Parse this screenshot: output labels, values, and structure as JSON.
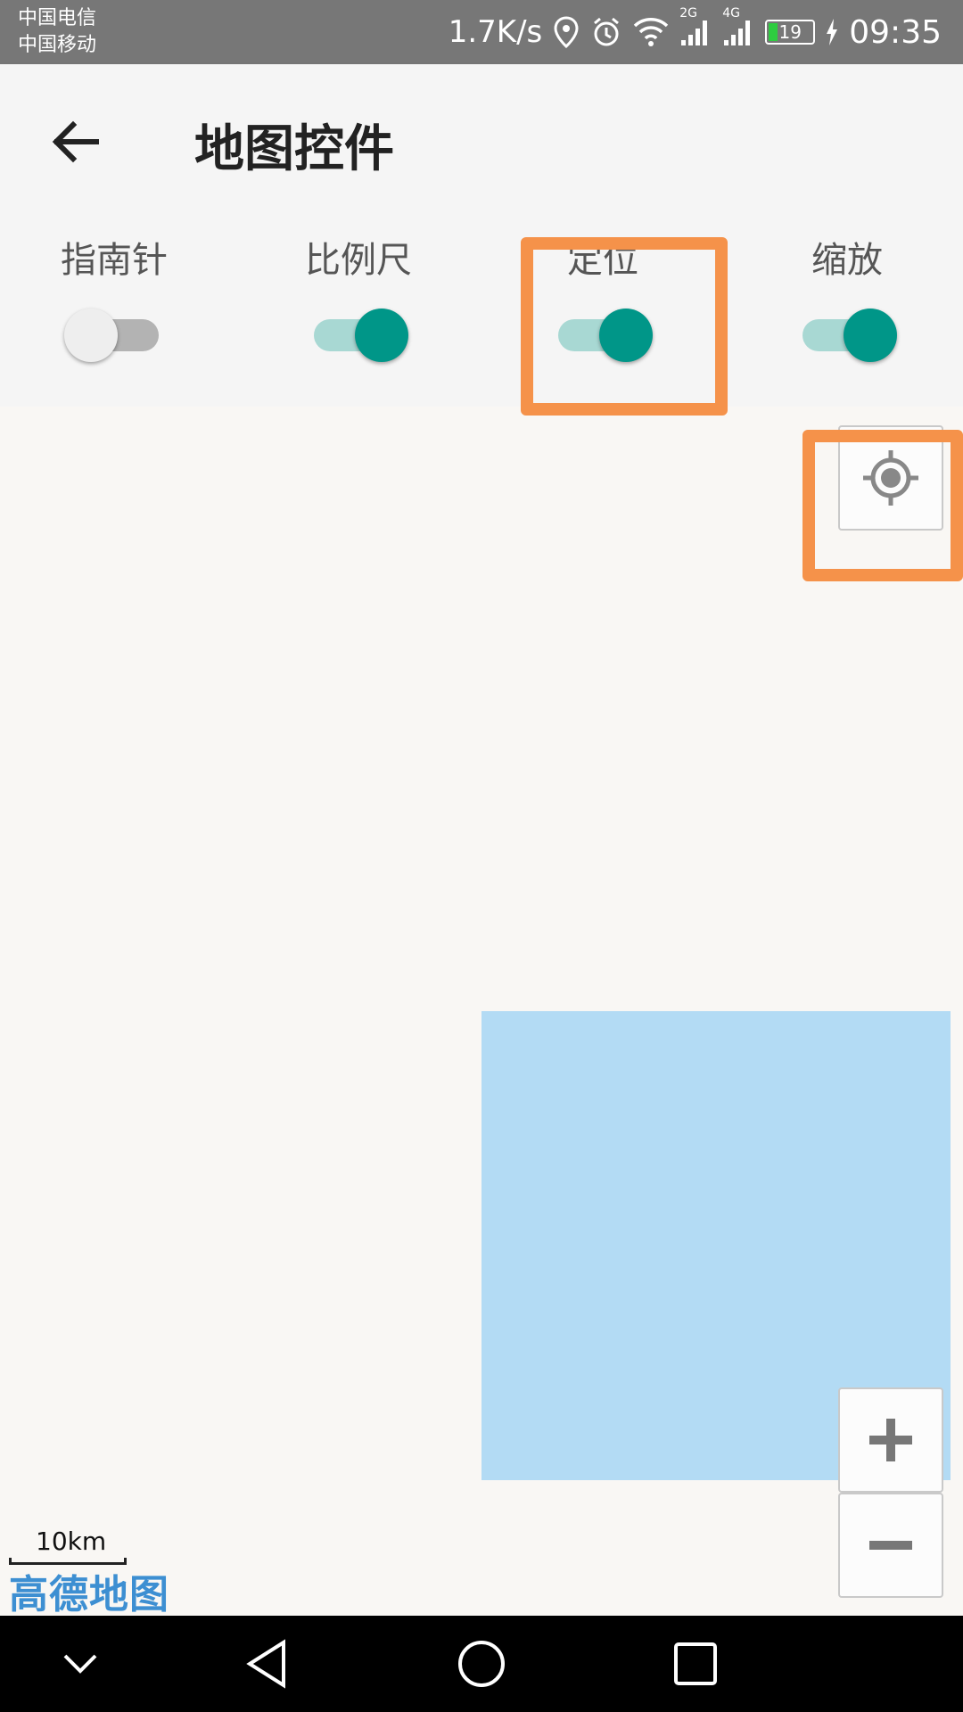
{
  "status_bar": {
    "carrier_1": "中国电信",
    "carrier_2": "中国移动",
    "net_speed": "1.7K/s",
    "signal_1_label": "2G",
    "signal_2_label": "4G",
    "battery_level": "19",
    "time": "09:35"
  },
  "app_bar": {
    "title": "地图控件",
    "switches": [
      {
        "label": "指南针",
        "on": false
      },
      {
        "label": "比例尺",
        "on": true
      },
      {
        "label": "定位",
        "on": true
      },
      {
        "label": "缩放",
        "on": true
      }
    ]
  },
  "map": {
    "scale_label": "10km",
    "logo": "高德地图",
    "water_color": "#b3dbf4"
  },
  "colors": {
    "accent": "#009688",
    "accent_track": "#a8d8d3",
    "highlight": "#f5924a",
    "switch_off_thumb": "#eeeeee",
    "switch_off_track": "#b3b3b3"
  },
  "icons": {
    "back": "arrow-left-icon",
    "locate": "crosshair-icon",
    "zoom_in": "plus-icon",
    "zoom_out": "minus-icon"
  }
}
